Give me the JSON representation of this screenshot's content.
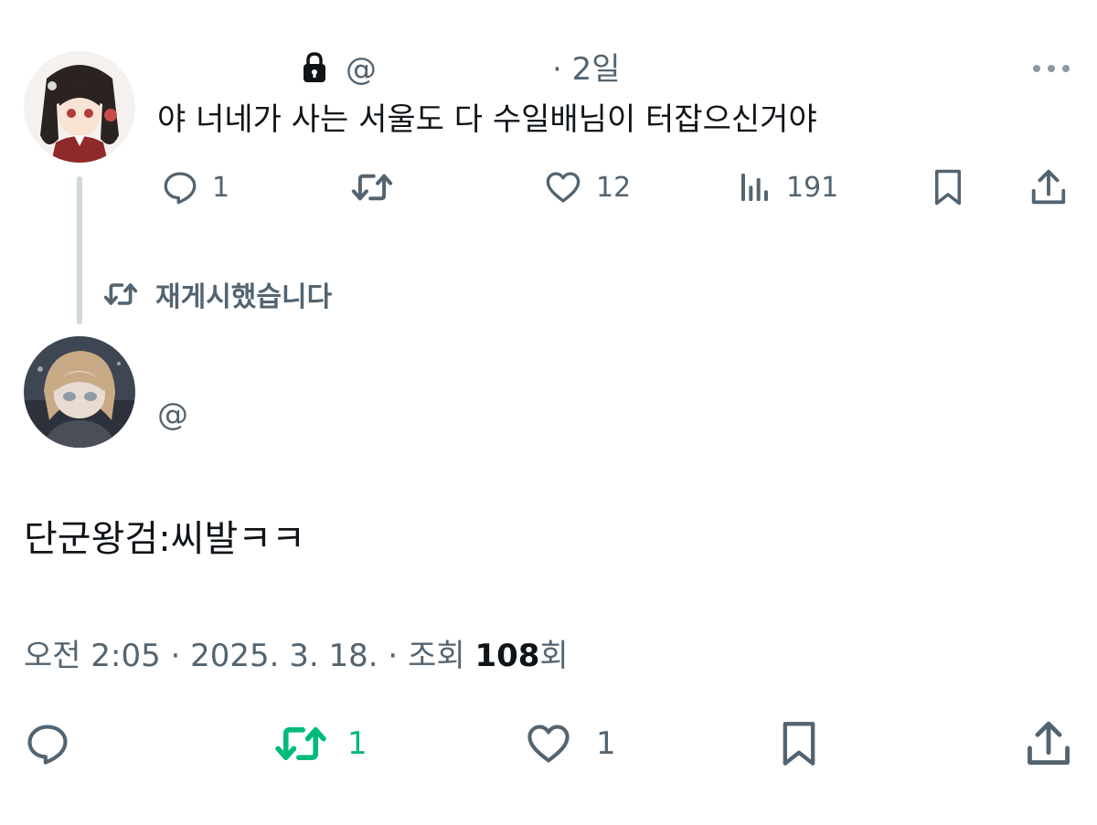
{
  "reply_tweet": {
    "handle_prefix": "@",
    "time_ago": "· 2일",
    "text": "야 너네가 사는 서울도 다 수일배님이 터잡으신거야",
    "actions": {
      "reply_count": "1",
      "retweet_count": "",
      "like_count": "12",
      "views_count": "191"
    }
  },
  "retweet_banner": {
    "label": "재게시했습니다"
  },
  "main_tweet": {
    "handle_prefix": "@",
    "text": "단군왕검:씨발ㅋㅋ",
    "footer": {
      "time": "오전 2:05",
      "sep1": " · ",
      "date": "2025. 3. 18.",
      "sep2": " · ",
      "views_label": "조회 ",
      "views_value": "108",
      "views_suffix": "회"
    },
    "actions": {
      "retweet_count": "1",
      "like_count": "1"
    }
  },
  "colors": {
    "secondary_text": "#536471",
    "retweet_active": "#00ba7c",
    "thread_line": "#cfd9de"
  }
}
